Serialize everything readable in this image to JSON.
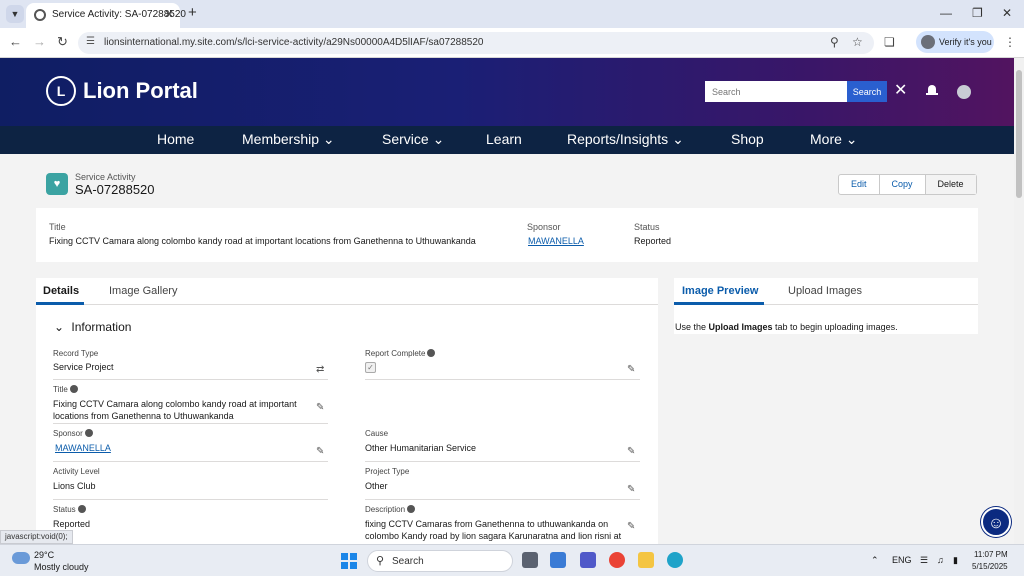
{
  "browser": {
    "tab_title": "Service Activity: SA-07288520",
    "url": "lionsinternational.my.site.com/s/lci-service-activity/a29Ns00000A4D5lIAF/sa07288520",
    "verify_label": "Verify it's you"
  },
  "portal": {
    "brand": "Lion Portal",
    "search_placeholder": "Search",
    "search_button": "Search"
  },
  "nav": {
    "home": "Home",
    "membership": "Membership",
    "service": "Service",
    "learn": "Learn",
    "reports": "Reports/Insights",
    "shop": "Shop",
    "more": "More"
  },
  "record": {
    "type": "Service Activity",
    "name": "SA-07288520",
    "actions": {
      "edit": "Edit",
      "copy": "Copy",
      "delete": "Delete"
    }
  },
  "highlights": {
    "title_label": "Title",
    "title_value": "Fixing CCTV Camara along colombo kandy road at important locations from Ganethenna to Uthuwankanda",
    "sponsor_label": "Sponsor",
    "sponsor_value": "MAWANELLA",
    "status_label": "Status",
    "status_value": "Reported"
  },
  "details": {
    "tab_details": "Details",
    "tab_gallery": "Image Gallery",
    "section": "Information",
    "fields": {
      "record_type_label": "Record Type",
      "record_type_value": "Service Project",
      "report_complete_label": "Report Complete",
      "title_label": "Title",
      "title_line1": "Fixing CCTV Camara along colombo kandy road at important",
      "title_line2": "locations from Ganethenna to Uthuwankanda",
      "sponsor_label": "Sponsor",
      "sponsor_value": "MAWANELLA",
      "cause_label": "Cause",
      "cause_value": "Other Humanitarian Service",
      "activity_level_label": "Activity Level",
      "activity_level_value": "Lions Club",
      "project_type_label": "Project Type",
      "project_type_value": "Other",
      "status_label": "Status",
      "status_value": "Reported",
      "description_label": "Description",
      "description_line1": "fixing CCTV Camaras from Ganethenna to uthuwankanda on",
      "description_line2": "colombo Kandy road by lion sagara Karunaratna and lion risni at"
    }
  },
  "preview": {
    "tab_preview": "Image Preview",
    "tab_upload": "Upload Images",
    "msg_prefix": "Use the ",
    "msg_bold": "Upload Images",
    "msg_suffix": " tab to begin uploading images."
  },
  "status_tip": "javascript:void(0);",
  "taskbar": {
    "temp": "29°C",
    "weather": "Mostly cloudy",
    "search": "Search",
    "lang": "ENG",
    "time": "11:07 PM",
    "date": "5/15/2025"
  },
  "colors": {
    "accent": "#0b5cab",
    "nav_bg": "#0d2343",
    "record_icon": "#3ba3a2"
  }
}
